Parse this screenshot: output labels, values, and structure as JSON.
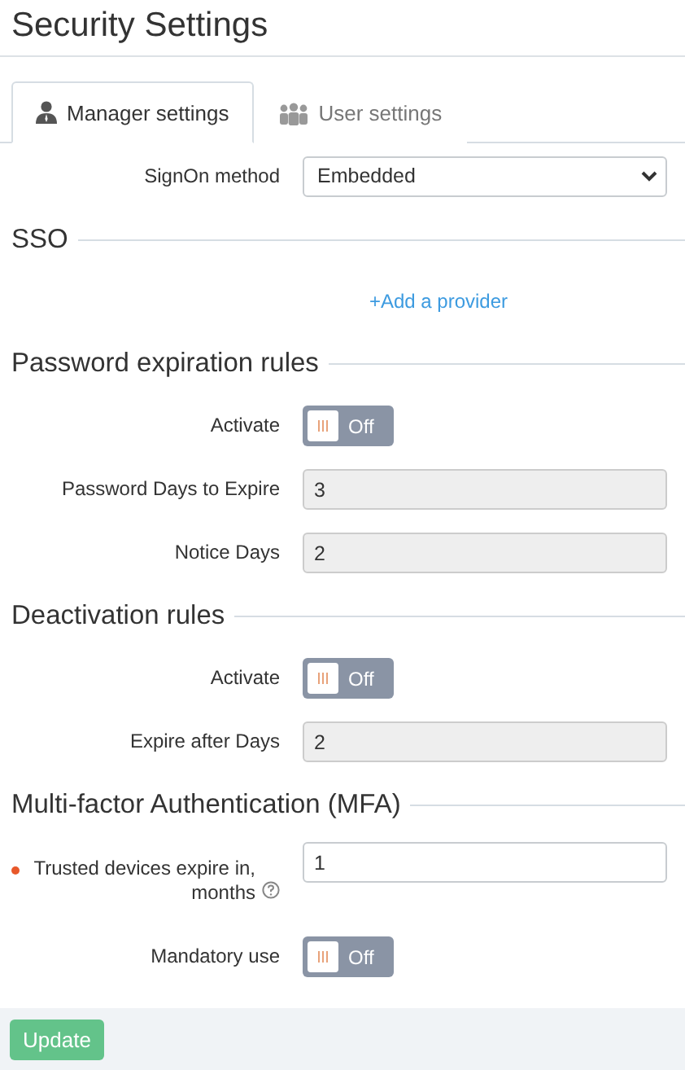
{
  "title": "Security Settings",
  "tabs": [
    {
      "label": "Manager settings",
      "kind": "single",
      "selected": true
    },
    {
      "label": "User settings",
      "kind": "group",
      "selected": false
    }
  ],
  "top_rows": [
    {
      "kind": "select",
      "label": "SignOn method",
      "value": "Embedded"
    }
  ],
  "sections": [
    {
      "heading": "SSO",
      "rows": [
        {
          "kind": "link",
          "text": "+Add a provider"
        }
      ]
    },
    {
      "heading": "Password expiration rules",
      "rows": [
        {
          "kind": "toggle",
          "label": "Activate",
          "on": false,
          "state_text": "Off"
        },
        {
          "kind": "readonly",
          "label": "Password Days to Expire",
          "value": "3"
        },
        {
          "kind": "readonly",
          "label": "Notice Days",
          "value": "2"
        }
      ]
    },
    {
      "heading": "Deactivation rules",
      "rows": [
        {
          "kind": "toggle",
          "label": "Activate",
          "on": false,
          "state_text": "Off"
        },
        {
          "kind": "readonly",
          "label": "Expire after Days",
          "value": "2"
        }
      ]
    },
    {
      "heading": "Multi-factor Authentication (MFA)",
      "rows": [
        {
          "kind": "input",
          "label": "Trusted devices expire in, months",
          "required": true,
          "help": true,
          "value": "1"
        },
        {
          "kind": "toggle",
          "label": "Mandatory use",
          "on": false,
          "state_text": "Off"
        }
      ]
    }
  ],
  "footer": {
    "button": "Update"
  }
}
